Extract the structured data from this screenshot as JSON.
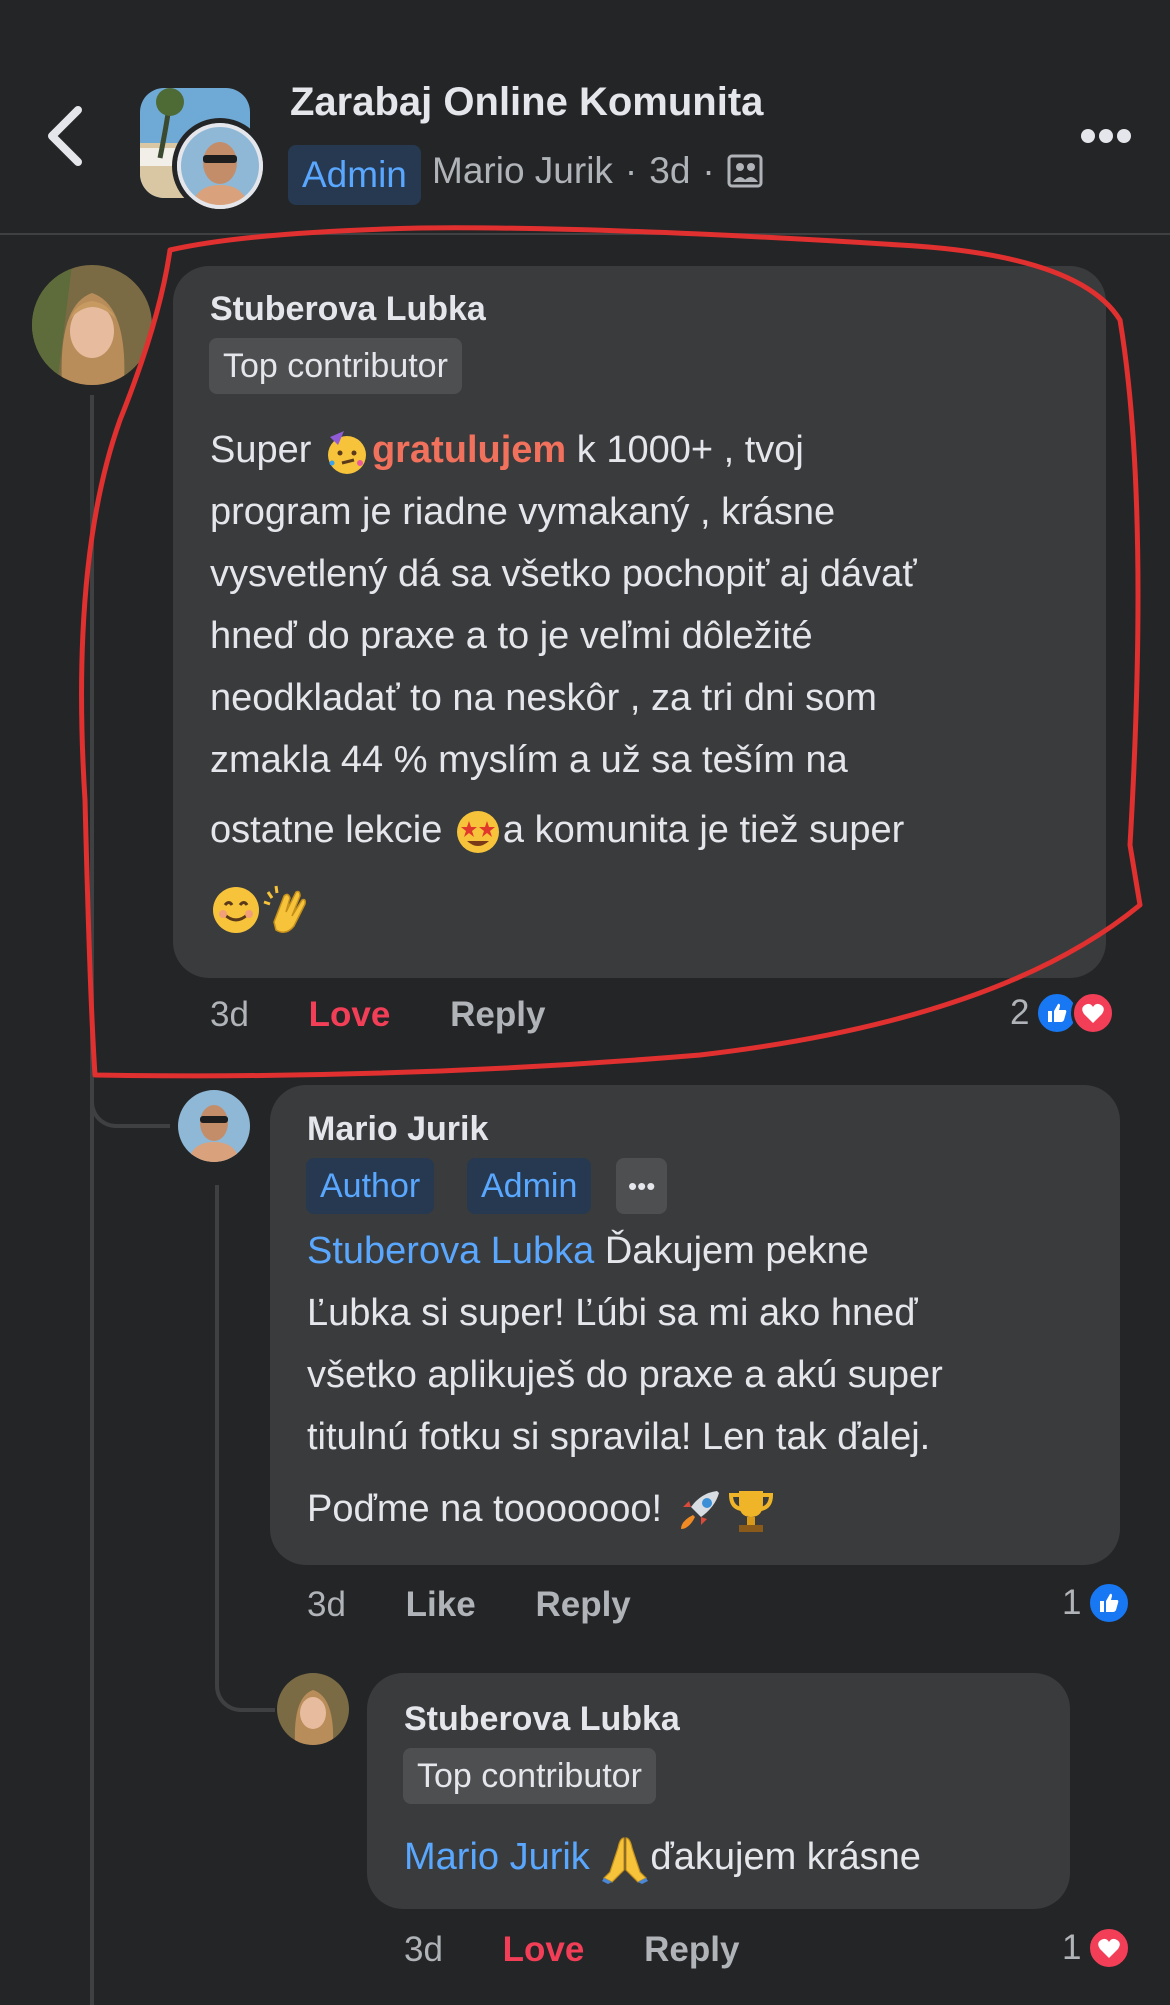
{
  "header": {
    "group_name": "Zarabaj Online Komunita",
    "admin_badge": "Admin",
    "poster_name": "Mario Jurik",
    "separator": "·",
    "age": "3d"
  },
  "comments": [
    {
      "author": "Stuberova Lubka",
      "badge": "Top contributor",
      "text": {
        "l1_pre": "Super ",
        "l1_accent": "gratulujem",
        "l1_post": " k 1000+ , tvoj",
        "l2": "program je riadne vymakaný , krásne",
        "l3": "vysvetlený dá sa všetko pochopiť aj dávať",
        "l4": "hneď do praxe a to je veľmi dôležité",
        "l5": "neodkladať to na neskôr , za tri dni som",
        "l6": "zmakla 44 % myslím a už sa teším na",
        "l7_pre": "ostatne lekcie ",
        "l7_post": "a komunita je tiež super"
      },
      "meta": {
        "time": "3d",
        "reaction_action": "Love",
        "reply": "Reply"
      },
      "reaction_count": "2"
    },
    {
      "author": "Mario Jurik",
      "badges": [
        "Author",
        "Admin"
      ],
      "more": "•••",
      "text": {
        "mention": "Stuberova Lubka",
        "l1_post": " Ďakujem pekne",
        "l2": "Ľubka si super! Ľúbi sa mi ako hneď",
        "l3": "všetko aplikuješ do praxe a akú super",
        "l4": "titulnú fotku si spravila! Len tak ďalej.",
        "l5": "Poďme na tooooooo! "
      },
      "meta": {
        "time": "3d",
        "reaction_action": "Like",
        "reply": "Reply"
      },
      "reaction_count": "1"
    },
    {
      "author": "Stuberova Lubka",
      "badge": "Top contributor",
      "text": {
        "mention": "Mario Jurik",
        "post": "ďakujem krásne"
      },
      "meta": {
        "time": "3d",
        "reaction_action": "Love",
        "reply": "Reply"
      },
      "reaction_count": "1"
    }
  ],
  "icons": {
    "back": "chevron-left-icon",
    "more": "more-dots-icon",
    "audience": "group-members-icon",
    "like": "like-icon",
    "love": "heart-icon"
  },
  "colors": {
    "background": "#242526",
    "bubble": "#3a3b3c",
    "link": "#5aa7ff",
    "love": "#f33e58",
    "like": "#1877f2",
    "highlight_ring": "#e03030"
  }
}
